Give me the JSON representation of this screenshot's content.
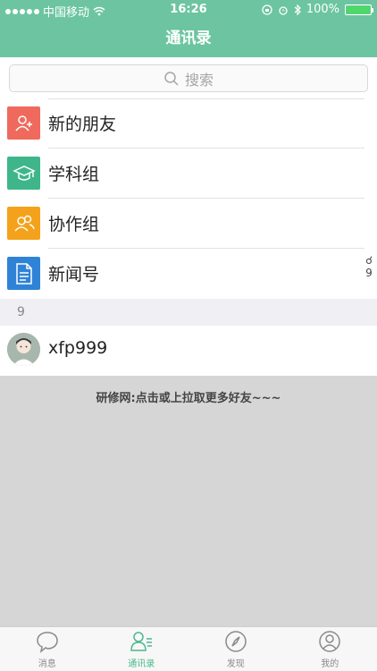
{
  "status": {
    "carrier": "中国移动",
    "time": "16:26",
    "battery": "100%"
  },
  "nav": {
    "title": "通讯录"
  },
  "search": {
    "placeholder": "搜索"
  },
  "menu": [
    {
      "label": "新的朋友",
      "color": "#ef6a5d",
      "icon": "add-person-icon"
    },
    {
      "label": "学科组",
      "color": "#3fb68a",
      "icon": "graduation-cap-icon"
    },
    {
      "label": "协作组",
      "color": "#f4a21b",
      "icon": "group-icon"
    },
    {
      "label": "新闻号",
      "color": "#2f83d6",
      "icon": "document-icon"
    }
  ],
  "section": {
    "header": "9"
  },
  "index": [
    "☌",
    "9"
  ],
  "contacts": [
    {
      "name": "xfp999"
    }
  ],
  "footer": {
    "tip": "研修网:点击或上拉取更多好友~~~"
  },
  "tabs": [
    {
      "label": "消息",
      "icon": "chat-bubble-icon",
      "active": false
    },
    {
      "label": "通讯录",
      "icon": "contacts-icon",
      "active": true
    },
    {
      "label": "发现",
      "icon": "compass-icon",
      "active": false
    },
    {
      "label": "我的",
      "icon": "profile-icon",
      "active": false
    }
  ],
  "colors": {
    "brand": "#6cc5a0",
    "active_tab": "#4cb88e"
  }
}
